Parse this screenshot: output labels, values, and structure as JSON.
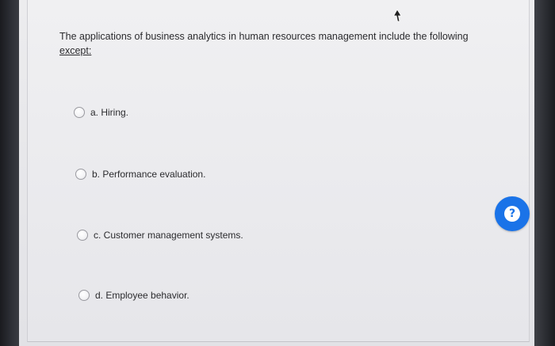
{
  "quiz": {
    "question": {
      "text": "The applications of business analytics in human resources management include the following",
      "except_text": "except:"
    },
    "options": [
      {
        "label": "a. Hiring.",
        "selected": false
      },
      {
        "label": "b. Performance evaluation.",
        "selected": false
      },
      {
        "label": "c. Customer management systems.",
        "selected": false
      },
      {
        "label": "d. Employee behavior.",
        "selected": false
      }
    ],
    "help_button": {
      "icon": "question-mark-icon",
      "glyph": "?"
    }
  },
  "colors": {
    "accent": "#1a73e8",
    "text": "#2b2b2e",
    "panel_background": "#ebebee",
    "radio_border": "#9a9aa0"
  }
}
